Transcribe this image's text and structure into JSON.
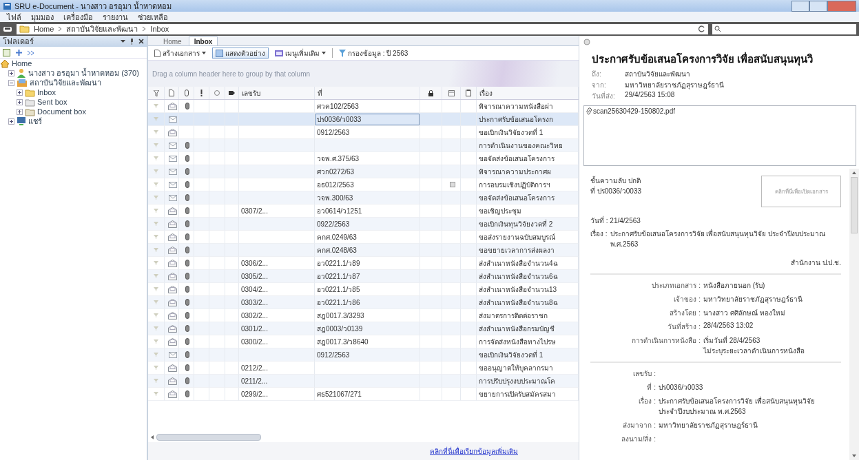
{
  "window": {
    "title": "SRU e-Document - นางสาว อรอุมา น้ำหาดหอม"
  },
  "menu": [
    "ไฟล์",
    "มุมมอง",
    "เครื่องมือ",
    "รายงาน",
    "ช่วยเหลือ"
  ],
  "address_bar": {
    "path": [
      "Home",
      "สถาบันวิจัยและพัฒนา",
      "Inbox"
    ]
  },
  "folder_panel": {
    "title": "โฟลเดอร์",
    "tree": [
      {
        "label": "Home",
        "kind": "home",
        "children": [
          {
            "label": "นางสาว อรอุมา น้ำหาดหอม (370)",
            "kind": "user",
            "expanded": false
          },
          {
            "label": "สถาบันวิจัยและพัฒนา",
            "kind": "department",
            "expanded": true,
            "children": [
              {
                "label": "Inbox",
                "kind": "inbox",
                "expanded": false
              },
              {
                "label": "Sent box",
                "kind": "sent",
                "expanded": false
              },
              {
                "label": "Document box",
                "kind": "document",
                "expanded": false
              }
            ]
          },
          {
            "label": "แชร์",
            "kind": "share",
            "expanded": false
          }
        ]
      }
    ]
  },
  "tabs": [
    {
      "label": "Home",
      "selected": false
    },
    {
      "label": "Inbox",
      "selected": true
    }
  ],
  "toolbar": [
    {
      "label": "สร้างเอกสาร",
      "kind": "dropdown",
      "on": false
    },
    {
      "label": "แสดงตัวอย่าง",
      "kind": "toggle",
      "on": true
    },
    {
      "label": "เมนูเพิ่มเติม",
      "kind": "dropdown",
      "on": false
    },
    {
      "label": "กรองข้อมูล : ปี 2563",
      "kind": "filter",
      "on": false
    }
  ],
  "group_hint": "Drag a column header here to group by that column",
  "table": {
    "columns": [
      "เลขรับ",
      "ที่",
      "เรื่อง"
    ],
    "rows": [
      {
        "read": true,
        "attachment": true,
        "flagged": false,
        "selected": false,
        "received_no": "",
        "ref_no": "ศวค102/2563",
        "subject": "พิจารณาความหนังสือผ่า"
      },
      {
        "read": false,
        "attachment": false,
        "flagged": false,
        "selected": true,
        "received_no": "",
        "ref_no": "ปร0036/ว0033",
        "subject": "ประกาศรับข้อเสนอโครงก"
      },
      {
        "read": true,
        "attachment": false,
        "flagged": false,
        "selected": false,
        "received_no": "",
        "ref_no": "0912/2563",
        "subject": "ขอเบิกเงินวิจัยงวดที่ 1"
      },
      {
        "read": false,
        "attachment": true,
        "flagged": false,
        "selected": false,
        "received_no": "",
        "ref_no": "",
        "subject": "การดำเนินงานของคณะวิทย"
      },
      {
        "read": false,
        "attachment": true,
        "flagged": false,
        "selected": false,
        "received_no": "",
        "ref_no": "วจพ.ศ.375/63",
        "subject": "ขอจัดส่งข้อเสนอโครงการ"
      },
      {
        "read": false,
        "attachment": true,
        "flagged": false,
        "selected": false,
        "received_no": "",
        "ref_no": "ศวก0272/63",
        "subject": "พิจารณาความประกาศผ"
      },
      {
        "read": false,
        "attachment": true,
        "flagged": true,
        "selected": false,
        "received_no": "",
        "ref_no": "อธ012/2563",
        "subject": "การอบรมเชิงปฏิบัติการฯ"
      },
      {
        "read": false,
        "attachment": true,
        "flagged": false,
        "selected": false,
        "received_no": "",
        "ref_no": "วจพ.300/63",
        "subject": "ขอจัดส่งข้อเสนอโครงการ"
      },
      {
        "read": true,
        "attachment": true,
        "flagged": false,
        "selected": false,
        "received_no": "0307/2...",
        "ref_no": "อว0614/ว1251",
        "subject": "ขอเชิญประชุม"
      },
      {
        "read": true,
        "attachment": true,
        "flagged": false,
        "selected": false,
        "received_no": "",
        "ref_no": "0922/2563",
        "subject": "ขอเบิกเงินทุนวิจัยงวดที่ 2"
      },
      {
        "read": true,
        "attachment": true,
        "flagged": false,
        "selected": false,
        "received_no": "",
        "ref_no": "คกศ.0249/63",
        "subject": "ขอส่งรายงานฉบับสมบูรณ์"
      },
      {
        "read": true,
        "attachment": true,
        "flagged": false,
        "selected": false,
        "received_no": "",
        "ref_no": "คกศ.0248/63",
        "subject": "ขอขยายเวลาการส่งผลงา"
      },
      {
        "read": true,
        "attachment": true,
        "flagged": false,
        "selected": false,
        "received_no": "0306/2...",
        "ref_no": "อว0221.1/ว89",
        "subject": "ส่งสำเนาหนังสือจำนวน4ฉ"
      },
      {
        "read": true,
        "attachment": true,
        "flagged": false,
        "selected": false,
        "received_no": "0305/2...",
        "ref_no": "อว0221.1/ว87",
        "subject": "ส่งสำเนาหนังสือจำนวน6ฉ"
      },
      {
        "read": true,
        "attachment": true,
        "flagged": false,
        "selected": false,
        "received_no": "0304/2...",
        "ref_no": "อว0221.1/ว85",
        "subject": "ส่งสำเนาหนังสือจำนวน13"
      },
      {
        "read": true,
        "attachment": true,
        "flagged": false,
        "selected": false,
        "received_no": "0303/2...",
        "ref_no": "อว0221.1/ว86",
        "subject": "ส่งสำเนาหนังสือจำนวน8ฉ"
      },
      {
        "read": true,
        "attachment": true,
        "flagged": false,
        "selected": false,
        "received_no": "0302/2...",
        "ref_no": "สฎ0017.3/3293",
        "subject": "ส่งมาตรการติดต่อราชก"
      },
      {
        "read": true,
        "attachment": true,
        "flagged": false,
        "selected": false,
        "received_no": "0301/2...",
        "ref_no": "สฎ0003/ว0139",
        "subject": "ส่งสำเนาหนังสือกรมบัญชี"
      },
      {
        "read": true,
        "attachment": true,
        "flagged": false,
        "selected": false,
        "received_no": "0300/2...",
        "ref_no": "สฎ0017.3/ว8640",
        "subject": "การจัดส่งหนังสือทางไปรษ"
      },
      {
        "read": false,
        "attachment": true,
        "flagged": false,
        "selected": false,
        "received_no": "",
        "ref_no": "0912/2563",
        "subject": "ขอเบิกเงินวิจัยงวดที่ 1"
      },
      {
        "read": true,
        "attachment": true,
        "flagged": false,
        "selected": false,
        "received_no": "0212/2...",
        "ref_no": "",
        "subject": "ขออนุญาตให้บุคลากรมา"
      },
      {
        "read": true,
        "attachment": true,
        "flagged": false,
        "selected": false,
        "received_no": "0211/2...",
        "ref_no": "",
        "subject": "การปรับปรุงงบประมาณโค"
      },
      {
        "read": true,
        "attachment": true,
        "flagged": false,
        "selected": false,
        "received_no": "0299/2...",
        "ref_no": "ศธ521067/271",
        "subject": "ขยายการเปิดรับสมัครสมา"
      }
    ]
  },
  "more_link": "คลิกที่นี่เพื่อเรียกข้อมูลเพิ่มเติม",
  "preview": {
    "title": "ประกาศรับข้อเสนอโครงการวิจัย เพื่อสนับสนุนทุนวิ",
    "header": [
      {
        "label": "ถึง:",
        "value": "สถาบันวิจัยและพัฒนา"
      },
      {
        "label": "จาก:",
        "value": "มหาวิทยาลัยราชภัฏสุราษฎร์ธานี"
      },
      {
        "label": "วันที่ส่ง:",
        "value": "29/4/2563 15:08"
      }
    ],
    "attachments": [
      "scan25630429-150802.pdf"
    ],
    "document": {
      "secrecy": "ชั้นความลับ ปกติ",
      "number": "ที่ ปร0036/ว0033",
      "open_button": "คลิกที่นี่เพื่อเปิดเอกสาร",
      "date": "วันที่ : 21/4/2563",
      "subject_label": "เรื่อง :",
      "subject": "ประกาศรับข้อเสนอโครงการวิจัย เพื่อสนับสนุนทุนวิจัย ประจำปีงบประมาณ พ.ศ.2563",
      "sender": "สำนักงาน ป.ป.ช."
    },
    "details": [
      {
        "label": "ประเภทเอกสาร :",
        "value": "หนังสือภายนอก (รับ)"
      },
      {
        "label": "เจ้าของ :",
        "value": "มหาวิทยาลัยราชภัฏสุราษฎร์ธานี"
      },
      {
        "label": "สร้างโดย :",
        "value": "นางสาว ศศิลักษณ์ ทองใหม่"
      },
      {
        "label": "วันที่สร้าง :",
        "value": "28/4/2563 13:02"
      },
      {
        "label": "การดำเนินการหนังสือ :",
        "value": "เริ่มวันที่ 28/4/2563\nไม่ระบุระยะเวลาดำเนินการหนังสือ"
      }
    ],
    "receipt": [
      {
        "label": "เลขรับ :"
      },
      {
        "label": "ที่ :",
        "value": "ปร0036/ว0033"
      },
      {
        "label": "เรื่อง :",
        "value": "ประกาศรับข้อเสนอโครงการวิจัย เพื่อสนับสนุนทุนวิจัย\nประจำปีงบประมาณ พ.ศ.2563"
      },
      {
        "label": "ส่งมาจาก :",
        "value": "มหาวิทยาลัยราชภัฏสุราษฎร์ธานี"
      },
      {
        "label": "ลงนาม/สั่ง :"
      }
    ]
  }
}
